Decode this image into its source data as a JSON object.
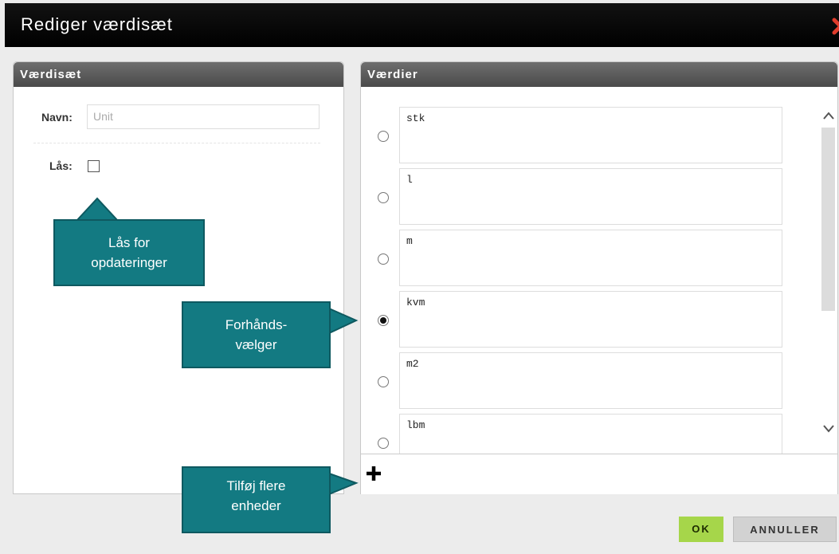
{
  "dialog": {
    "title": "Rediger værdisæt"
  },
  "left_panel": {
    "header": "Værdisæt",
    "name_label": "Navn:",
    "name_placeholder": "Unit",
    "lock_label": "Lås:",
    "lock_checked": false
  },
  "right_panel": {
    "header": "Værdier",
    "values": [
      {
        "text": "stk",
        "selected": false
      },
      {
        "text": "l",
        "selected": false
      },
      {
        "text": "m",
        "selected": false
      },
      {
        "text": "kvm",
        "selected": true
      },
      {
        "text": "m2",
        "selected": false
      },
      {
        "text": "lbm",
        "selected": false
      }
    ]
  },
  "callouts": {
    "lock": [
      "Lås for",
      "opdateringer"
    ],
    "preselect": [
      "Forhånds-",
      "vælger"
    ],
    "add_more": [
      "Tilføj flere",
      "enheder"
    ]
  },
  "buttons": {
    "ok": "OK",
    "cancel": "ANNULLER"
  },
  "icons": {
    "close": "close-x-icon",
    "add": "plus-icon",
    "scroll_up": "chevron-up-icon",
    "scroll_down": "chevron-down-icon"
  },
  "colors": {
    "titlebar": "#000000",
    "callout": "#137a82",
    "ok_button": "#a6d64a",
    "close_icon": "#e03b2b"
  }
}
